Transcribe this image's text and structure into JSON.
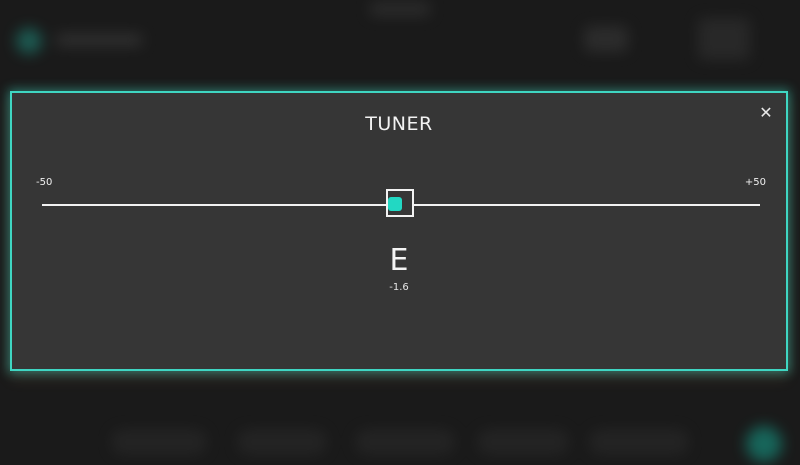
{
  "tuner": {
    "title": "TUNER",
    "close_symbol": "✕",
    "scale_min": "-50",
    "scale_max": "+50",
    "note": "E",
    "cents": "-1.6",
    "offset_fraction": -0.016,
    "accent_color": "#22d8c3",
    "border_color": "#3fd6c2"
  },
  "icons": {
    "close": "close-icon"
  }
}
